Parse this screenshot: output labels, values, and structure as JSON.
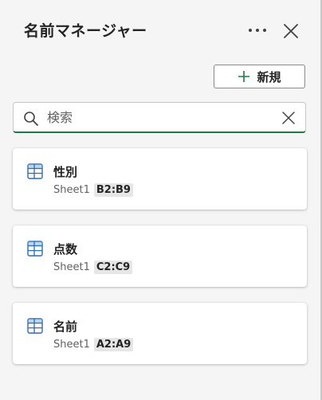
{
  "header": {
    "title": "名前マネージャー",
    "more_icon": "more-horizontal-icon",
    "close_icon": "close-icon"
  },
  "toolbar": {
    "new_label": "新規",
    "new_icon": "plus-icon"
  },
  "search": {
    "placeholder": "検索",
    "value": "",
    "icon": "search-icon",
    "clear_icon": "clear-icon"
  },
  "names": [
    {
      "name": "性別",
      "sheet": "Sheet1",
      "range": "B2:B9",
      "icon": "named-range-grid-icon"
    },
    {
      "name": "点数",
      "sheet": "Sheet1",
      "range": "C2:C9",
      "icon": "named-range-grid-icon"
    },
    {
      "name": "名前",
      "sheet": "Sheet1",
      "range": "A2:A9",
      "icon": "named-range-grid-icon"
    }
  ],
  "colors": {
    "accent_green": "#1e7a46",
    "icon_blue": "#2b6cb0",
    "background": "#f5f5f5"
  }
}
